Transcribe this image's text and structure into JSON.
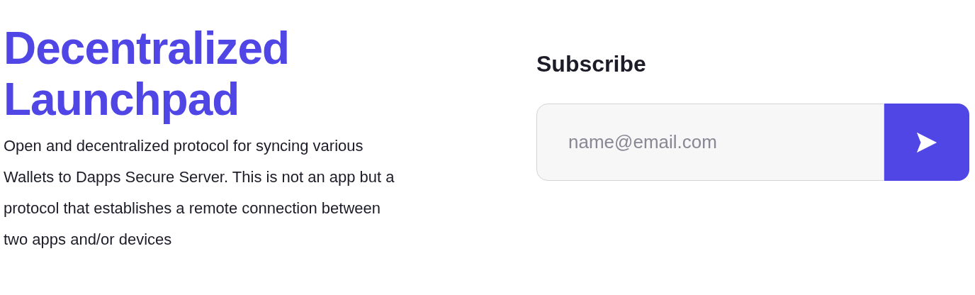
{
  "hero": {
    "title_lines": [
      "Decentralized",
      "Launchpad"
    ],
    "description": "Open and decentralized protocol for syncing various Wallets to Dapps Secure Server. This is not an app but a protocol that establishes a remote connection between two apps and/or devices"
  },
  "subscribe": {
    "heading": "Subscribe",
    "placeholder": "name@email.com"
  }
}
